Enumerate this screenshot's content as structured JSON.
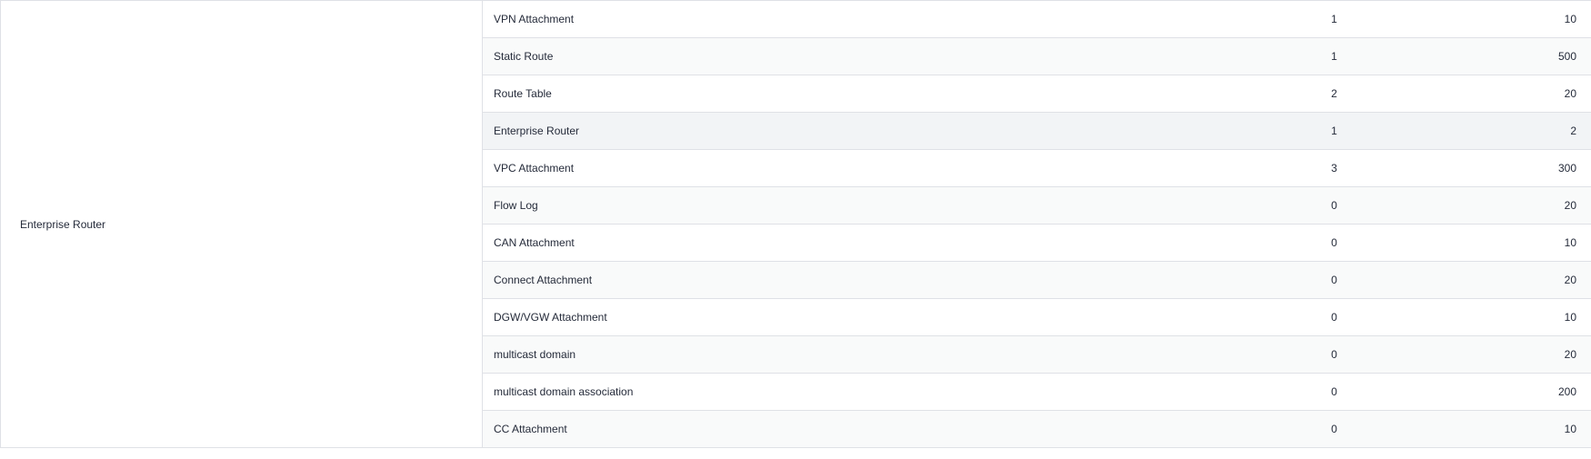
{
  "group_label": "Enterprise Router",
  "rows": [
    {
      "item": "VPN Attachment",
      "used": "1",
      "total": "10"
    },
    {
      "item": "Static Route",
      "used": "1",
      "total": "500"
    },
    {
      "item": "Route Table",
      "used": "2",
      "total": "20"
    },
    {
      "item": "Enterprise Router",
      "used": "1",
      "total": "2"
    },
    {
      "item": "VPC Attachment",
      "used": "3",
      "total": "300"
    },
    {
      "item": "Flow Log",
      "used": "0",
      "total": "20"
    },
    {
      "item": "CAN Attachment",
      "used": "0",
      "total": "10"
    },
    {
      "item": "Connect Attachment",
      "used": "0",
      "total": "20"
    },
    {
      "item": "DGW/VGW Attachment",
      "used": "0",
      "total": "10"
    },
    {
      "item": "multicast domain",
      "used": "0",
      "total": "20"
    },
    {
      "item": "multicast domain association",
      "used": "0",
      "total": "200"
    },
    {
      "item": "CC Attachment",
      "used": "0",
      "total": "10"
    }
  ]
}
